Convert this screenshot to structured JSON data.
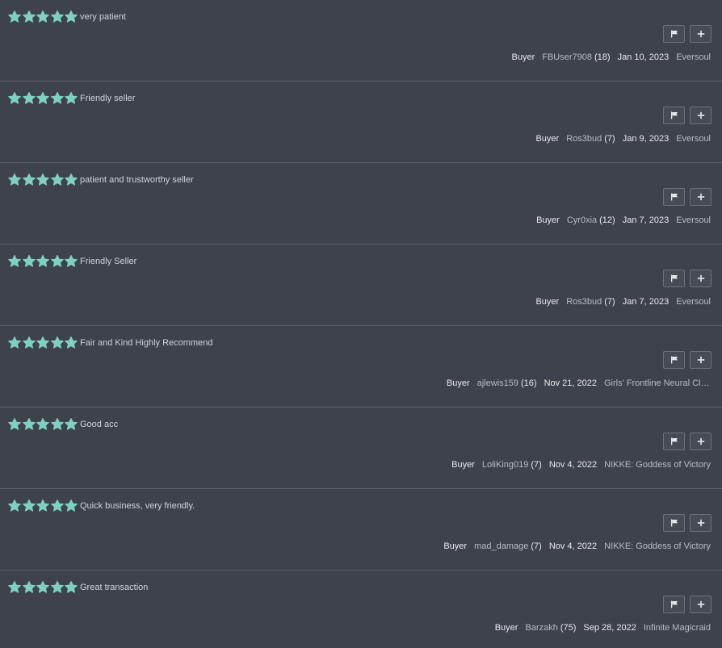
{
  "colors": {
    "background": "#3e434b",
    "star": "#7fd0c3",
    "divider": "#5b6169"
  },
  "icons": {
    "rating_star": "star-icon",
    "flag_button": "flag-icon",
    "add_button": "plus-icon"
  },
  "reviews": [
    {
      "rating": 5,
      "comment": "very patient",
      "role": "Buyer",
      "user": "FBUser7908",
      "count": "(18)",
      "date": "Jan 10, 2023",
      "game": "Eversoul"
    },
    {
      "rating": 5,
      "comment": "Friendly seller",
      "role": "Buyer",
      "user": "Ros3bud",
      "count": "(7)",
      "date": "Jan 9, 2023",
      "game": "Eversoul"
    },
    {
      "rating": 5,
      "comment": "patient and trustworthy seller",
      "role": "Buyer",
      "user": "Cyr0xia",
      "count": "(12)",
      "date": "Jan 7, 2023",
      "game": "Eversoul"
    },
    {
      "rating": 5,
      "comment": "Friendly Seller",
      "role": "Buyer",
      "user": "Ros3bud",
      "count": "(7)",
      "date": "Jan 7, 2023",
      "game": "Eversoul"
    },
    {
      "rating": 5,
      "comment": "Fair and Kind Highly Recommend",
      "role": "Buyer",
      "user": "ajlewis159",
      "count": "(16)",
      "date": "Nov 21, 2022",
      "game": "Girls' Frontline Neural Clou..."
    },
    {
      "rating": 5,
      "comment": "Good acc",
      "role": "Buyer",
      "user": "LoliKing019",
      "count": "(7)",
      "date": "Nov 4, 2022",
      "game": "NIKKE: Goddess of Victory"
    },
    {
      "rating": 5,
      "comment": "Quick business, very friendly.",
      "role": "Buyer",
      "user": "mad_damage",
      "count": "(7)",
      "date": "Nov 4, 2022",
      "game": "NIKKE: Goddess of Victory"
    },
    {
      "rating": 5,
      "comment": "Great transaction",
      "role": "Buyer",
      "user": "Barzakh",
      "count": "(75)",
      "date": "Sep 28, 2022",
      "game": "Infinite Magicraid"
    }
  ]
}
